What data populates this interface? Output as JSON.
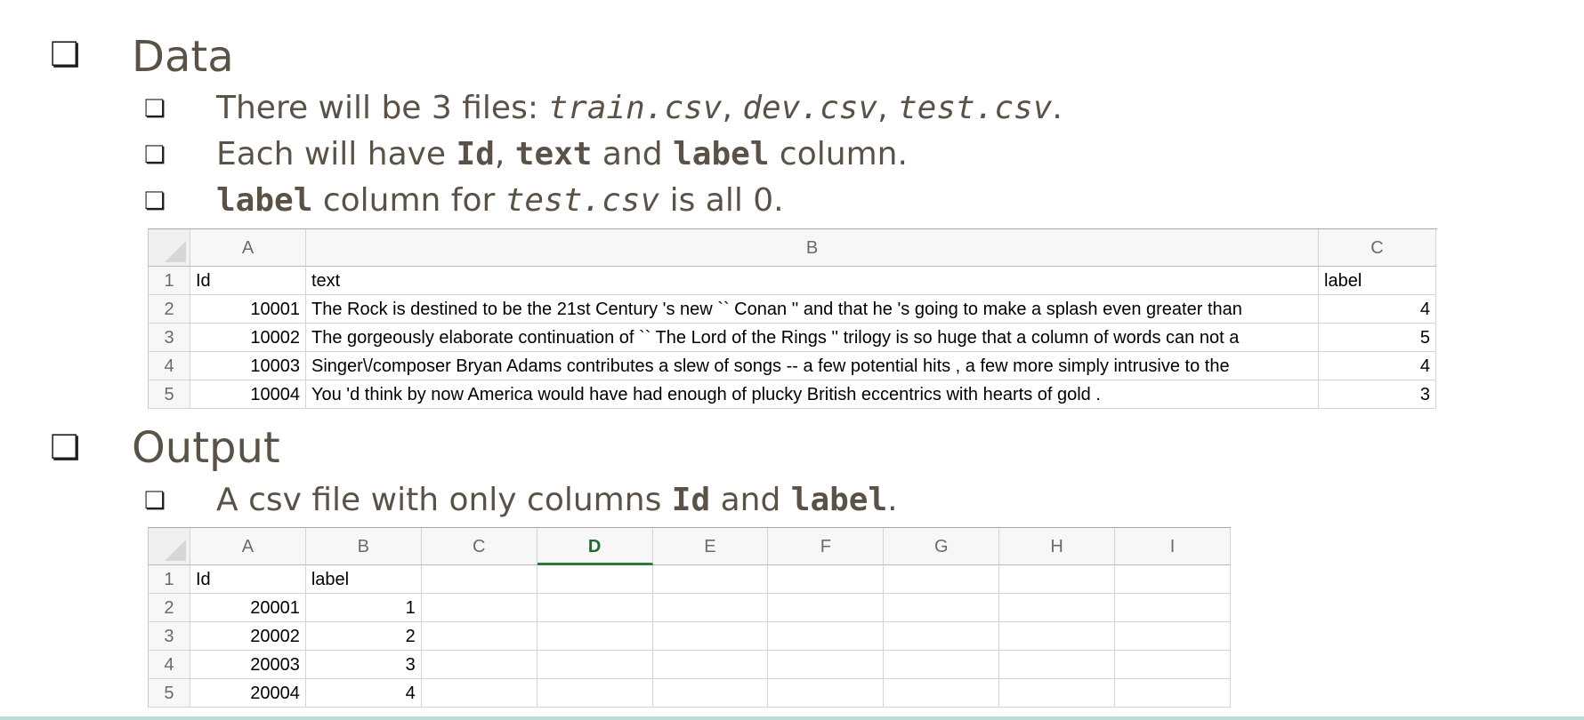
{
  "sections": {
    "data": {
      "title": "Data",
      "items": {
        "files": {
          "prefix": "There will be 3 files: ",
          "f1": "train.csv",
          "sep1": ", ",
          "f2": "dev.csv",
          "sep2": ", ",
          "f3": "test.csv",
          "suffix": "."
        },
        "columns": {
          "prefix": "Each will have ",
          "c1": "Id",
          "sep1": ", ",
          "c2": "text",
          "mid": " and ",
          "c3": "label",
          "suffix": " column."
        },
        "testlabel": {
          "c1": "label",
          "mid": " column for ",
          "f1": "test.csv",
          "suffix": " is all 0."
        }
      }
    },
    "output": {
      "title": "Output",
      "items": {
        "csv": {
          "prefix": "A csv file with only columns ",
          "c1": "Id",
          "mid": " and ",
          "c2": "label",
          "suffix": "."
        }
      }
    }
  },
  "bullet_glyph": "❏",
  "sheet1": {
    "col_headers": [
      "A",
      "B",
      "C"
    ],
    "rows": [
      {
        "n": "1",
        "a": "Id",
        "b": "text",
        "c": "label"
      },
      {
        "n": "2",
        "a": "10001",
        "b": "The Rock is destined to be the 21st Century 's new `` Conan '' and that he 's going to make a splash even greater than",
        "c": "4"
      },
      {
        "n": "3",
        "a": "10002",
        "b": "The gorgeously elaborate continuation of `` The Lord of the Rings '' trilogy is so huge that a column of words can not a",
        "c": "5"
      },
      {
        "n": "4",
        "a": "10003",
        "b": "Singer\\/composer Bryan Adams contributes a slew of songs -- a few potential hits , a few more simply intrusive to the",
        "c": "4"
      },
      {
        "n": "5",
        "a": "10004",
        "b": "You 'd think by now America would have had enough of plucky British eccentrics with hearts of gold .",
        "c": "3"
      }
    ]
  },
  "sheet2": {
    "col_headers": [
      "A",
      "B",
      "C",
      "D",
      "E",
      "F",
      "G",
      "H",
      "I"
    ],
    "selected_col": "D",
    "rows": [
      {
        "n": "1",
        "a": "Id",
        "b": "label"
      },
      {
        "n": "2",
        "a": "20001",
        "b": "1"
      },
      {
        "n": "3",
        "a": "20002",
        "b": "2"
      },
      {
        "n": "4",
        "a": "20003",
        "b": "3"
      },
      {
        "n": "5",
        "a": "20004",
        "b": "4"
      }
    ]
  }
}
